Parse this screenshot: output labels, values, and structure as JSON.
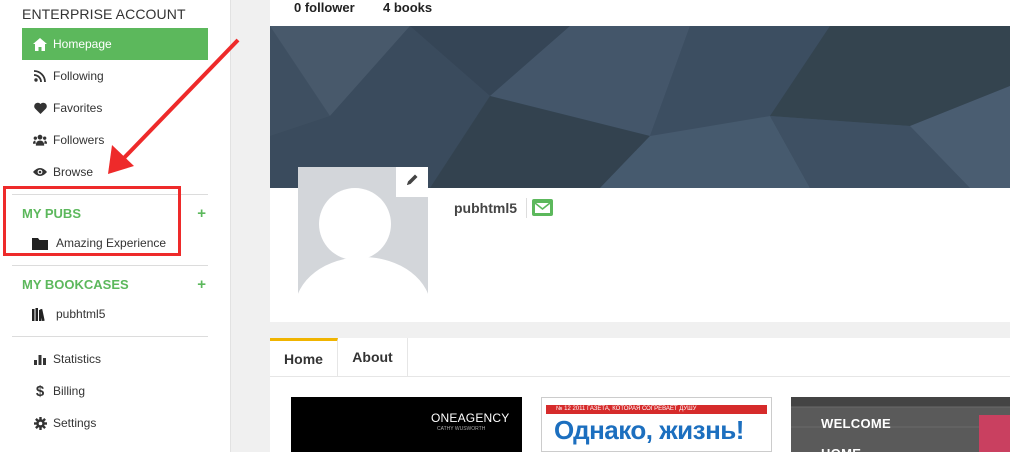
{
  "sidebar": {
    "account_title": "ENTERPRISE ACCOUNT",
    "nav": [
      {
        "label": "Homepage",
        "icon": "home-icon",
        "active": true
      },
      {
        "label": "Following",
        "icon": "rss-icon"
      },
      {
        "label": "Favorites",
        "icon": "heart-icon"
      },
      {
        "label": "Followers",
        "icon": "users-icon"
      },
      {
        "label": "Browse",
        "icon": "eye-icon"
      }
    ],
    "my_pubs": {
      "title": "MY PUBS",
      "add": "+",
      "items": [
        {
          "label": "Amazing Experience",
          "icon": "folder-icon"
        }
      ]
    },
    "my_bookcases": {
      "title": "MY BOOKCASES",
      "add": "+",
      "items": [
        {
          "label": "pubhtml5",
          "icon": "bookcase-icon"
        }
      ]
    },
    "bottom_nav": [
      {
        "label": "Statistics",
        "icon": "bar-chart-icon"
      },
      {
        "label": "Billing",
        "icon": "dollar-icon"
      },
      {
        "label": "Settings",
        "icon": "gear-icon"
      }
    ]
  },
  "stats": {
    "followers": "0 follower",
    "books": "4 books"
  },
  "profile": {
    "username": "pubhtml5"
  },
  "tabs": [
    "Home",
    "About"
  ],
  "books": [
    {
      "title": "ONEAGENCY",
      "subtitle": "CATHY WUSWORTH"
    },
    {
      "title": "Однако, жизнь!",
      "header": "№ 12 2011  ГАЗЕТА, КОТОРАЯ СОГРЕВАЕТ ДУШУ"
    },
    {
      "title": "WELCOME HOME"
    }
  ],
  "colors": {
    "accent": "#5cb85c",
    "tab_active": "#f0b400",
    "annotation": "#ee2a2a",
    "banner": "#3e4f61"
  }
}
